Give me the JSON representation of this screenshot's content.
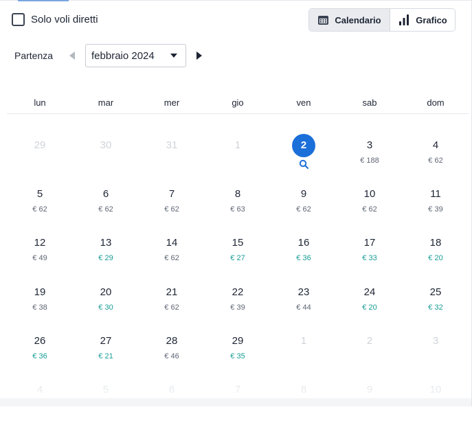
{
  "direct_flights": {
    "label": "Solo voli diretti",
    "checked": false
  },
  "view_toggle": {
    "calendar_label": "Calendario",
    "chart_label": "Grafico",
    "active": "calendar",
    "calendar_icon": "calendar-icon",
    "chart_icon": "bar-chart-icon"
  },
  "departure": {
    "label": "Partenza",
    "month": "febbraio 2024",
    "prev_icon": "triangle-left-icon",
    "next_icon": "triangle-right-icon"
  },
  "weekdays": [
    "lun",
    "mar",
    "mer",
    "gio",
    "ven",
    "sab",
    "dom"
  ],
  "colors": {
    "accent": "#1b6fd9",
    "cheap": "#169c94",
    "price": "#5d6573",
    "muted": "#cfd3d9"
  },
  "weeks": [
    [
      {
        "day": "29",
        "out": true
      },
      {
        "day": "30",
        "out": true
      },
      {
        "day": "31",
        "out": true
      },
      {
        "day": "1",
        "out": true
      },
      {
        "day": "2",
        "selected": true,
        "search_icon": "search-icon"
      },
      {
        "day": "3",
        "price": "€ 188"
      },
      {
        "day": "4",
        "price": "€ 62"
      }
    ],
    [
      {
        "day": "5",
        "price": "€ 62"
      },
      {
        "day": "6",
        "price": "€ 62"
      },
      {
        "day": "7",
        "price": "€ 62"
      },
      {
        "day": "8",
        "price": "€ 63"
      },
      {
        "day": "9",
        "price": "€ 62"
      },
      {
        "day": "10",
        "price": "€ 62"
      },
      {
        "day": "11",
        "price": "€ 39"
      }
    ],
    [
      {
        "day": "12",
        "price": "€ 49"
      },
      {
        "day": "13",
        "price": "€ 29",
        "cheap": true
      },
      {
        "day": "14",
        "price": "€ 62"
      },
      {
        "day": "15",
        "price": "€ 27",
        "cheap": true
      },
      {
        "day": "16",
        "price": "€ 36",
        "cheap": true
      },
      {
        "day": "17",
        "price": "€ 33",
        "cheap": true
      },
      {
        "day": "18",
        "price": "€ 20",
        "cheap": true
      }
    ],
    [
      {
        "day": "19",
        "price": "€ 38"
      },
      {
        "day": "20",
        "price": "€ 30",
        "cheap": true
      },
      {
        "day": "21",
        "price": "€ 62"
      },
      {
        "day": "22",
        "price": "€ 39"
      },
      {
        "day": "23",
        "price": "€ 44"
      },
      {
        "day": "24",
        "price": "€ 20",
        "cheap": true
      },
      {
        "day": "25",
        "price": "€ 32",
        "cheap": true
      }
    ],
    [
      {
        "day": "26",
        "price": "€ 36",
        "cheap": true
      },
      {
        "day": "27",
        "price": "€ 21",
        "cheap": true
      },
      {
        "day": "28",
        "price": "€ 46"
      },
      {
        "day": "29",
        "price": "€ 35",
        "cheap": true
      },
      {
        "day": "1",
        "out": true
      },
      {
        "day": "2",
        "out": true
      },
      {
        "day": "3",
        "out": true
      }
    ],
    [
      {
        "day": "4",
        "out": true
      },
      {
        "day": "5",
        "out": true
      },
      {
        "day": "6",
        "out": true
      },
      {
        "day": "7",
        "out": true
      },
      {
        "day": "8",
        "out": true
      },
      {
        "day": "9",
        "out": true
      },
      {
        "day": "10",
        "out": true
      }
    ]
  ]
}
